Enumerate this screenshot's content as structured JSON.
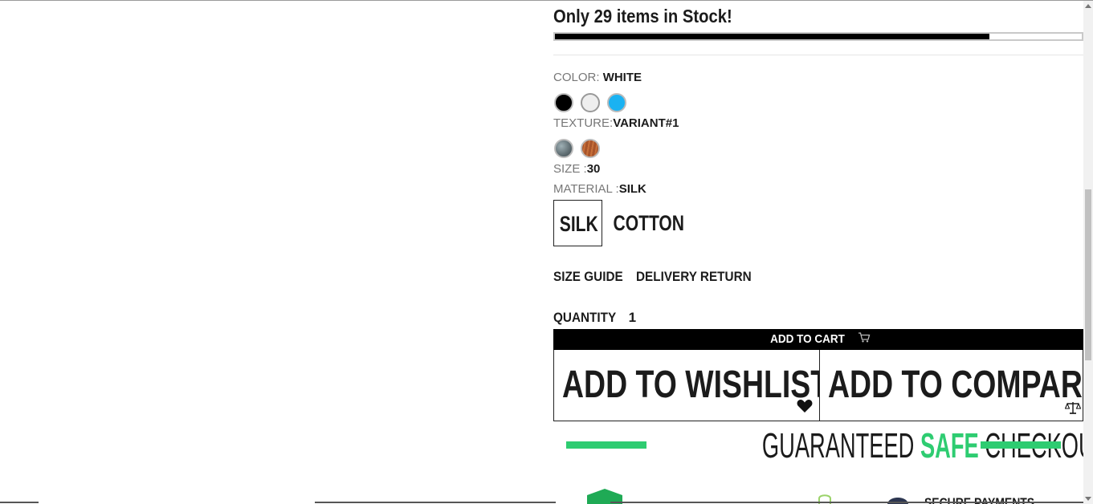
{
  "stock": {
    "text": "Only 29 items in Stock!",
    "fill_fraction": 0.825
  },
  "color": {
    "label": "COLOR:",
    "selected": "WHITE",
    "swatches": [
      {
        "name": "black",
        "hex": "#000000"
      },
      {
        "name": "white",
        "hex": "#eeeeee"
      },
      {
        "name": "blue",
        "hex": "#1ab2f2"
      }
    ]
  },
  "texture": {
    "label": "TEXTURE:",
    "selected": "VARIANT#1",
    "swatches": [
      {
        "name": "marble",
        "hex": "#5f6d72"
      },
      {
        "name": "wood",
        "hex": "#a8542a"
      }
    ]
  },
  "size": {
    "label": "SIZE :",
    "selected": "30"
  },
  "material": {
    "label": "MATERIAL :",
    "selected": "SILK",
    "options": [
      "SILK",
      "COTTON"
    ]
  },
  "links": {
    "size_guide": "SIZE GUIDE",
    "delivery_return": "DELIVERY RETURN"
  },
  "quantity": {
    "label": "QUANTITY",
    "value": "1"
  },
  "buttons": {
    "add_to_cart": "ADD TO CART",
    "add_to_wishlist": "ADD TO WISHLIST",
    "add_to_compare": "ADD TO COMPARE"
  },
  "checkout": {
    "part1": "GUARANTEED ",
    "part2": "SAFE",
    "part3": " CHECKOUT",
    "accent": "#2ecc71"
  },
  "badges": {
    "secure_text": "SECURE PAYMENTS"
  }
}
